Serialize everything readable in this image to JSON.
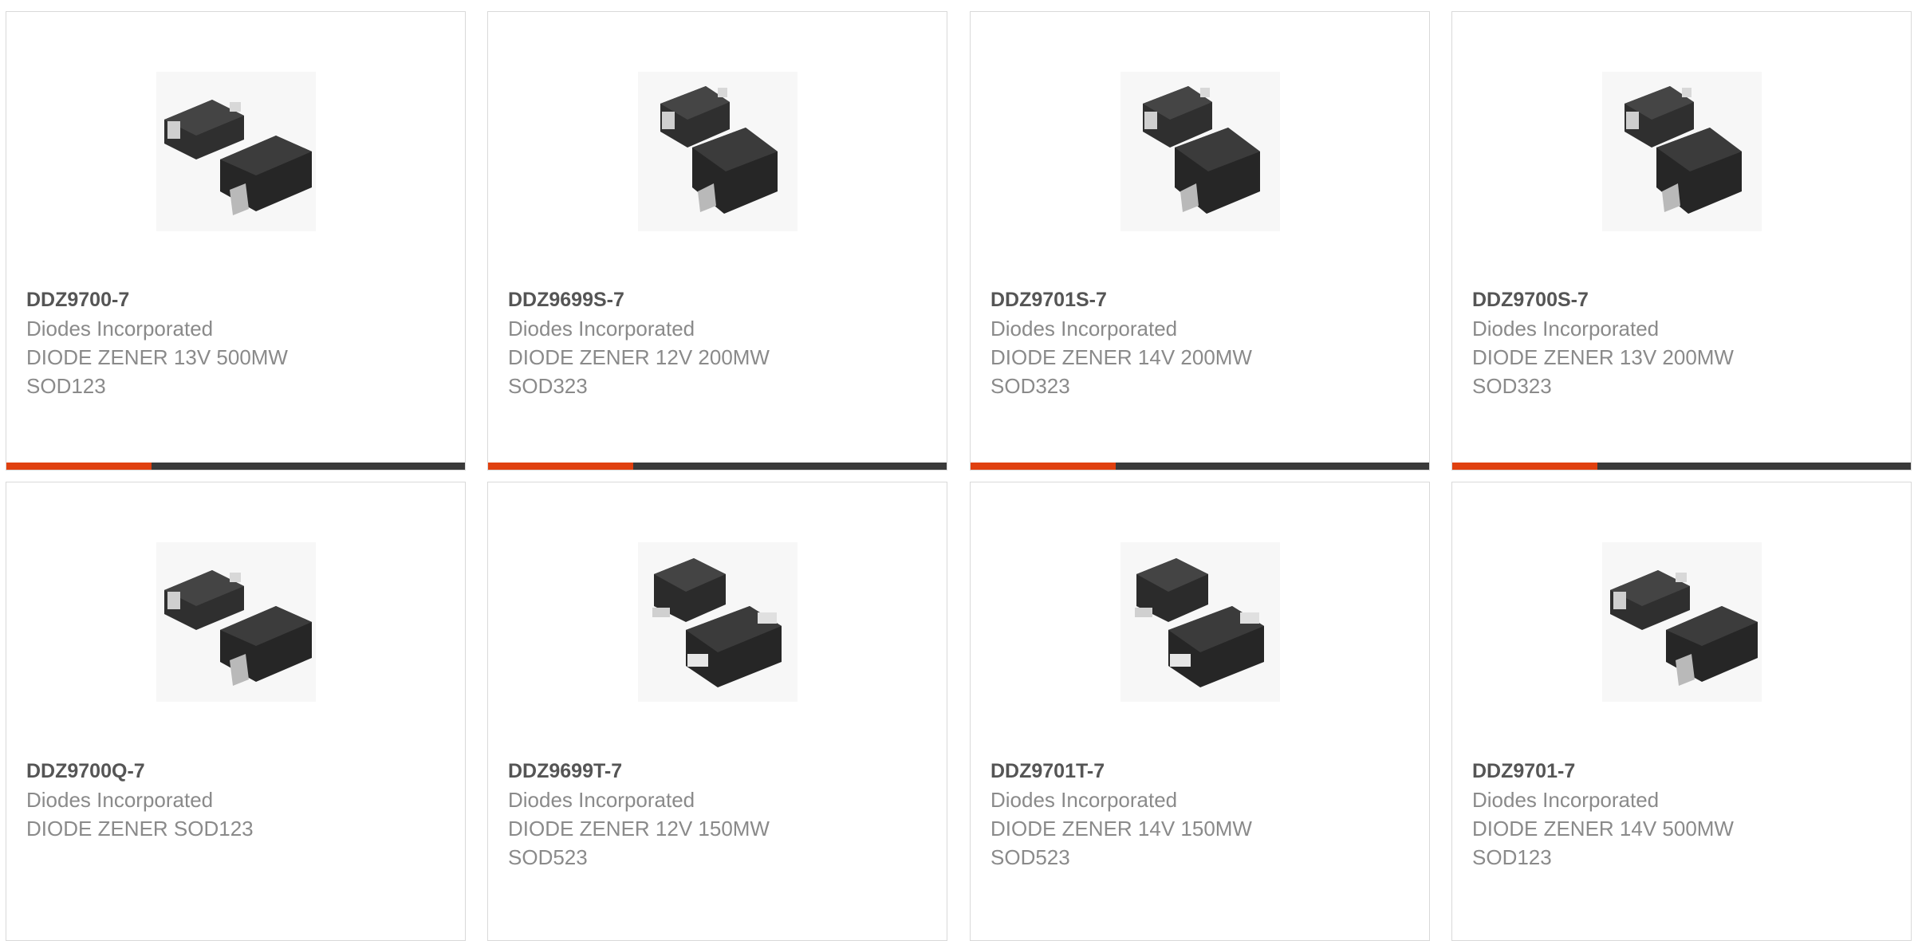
{
  "products": [
    {
      "part_number": "DDZ9700-7",
      "manufacturer": "Diodes Incorporated",
      "desc_line1": "DIODE ZENER 13V 500MW",
      "desc_line2": "SOD123",
      "package_icon": "sod123-package-icon"
    },
    {
      "part_number": "DDZ9699S-7",
      "manufacturer": "Diodes Incorporated",
      "desc_line1": "DIODE ZENER 12V 200MW",
      "desc_line2": "SOD323",
      "package_icon": "sod323-package-icon"
    },
    {
      "part_number": "DDZ9701S-7",
      "manufacturer": "Diodes Incorporated",
      "desc_line1": "DIODE ZENER 14V 200MW",
      "desc_line2": "SOD323",
      "package_icon": "sod323-package-icon"
    },
    {
      "part_number": "DDZ9700S-7",
      "manufacturer": "Diodes Incorporated",
      "desc_line1": "DIODE ZENER 13V 200MW",
      "desc_line2": "SOD323",
      "package_icon": "sod323-package-icon"
    },
    {
      "part_number": "DDZ9700Q-7",
      "manufacturer": "Diodes Incorporated",
      "desc_line1": "DIODE ZENER SOD123",
      "desc_line2": "",
      "package_icon": "sod123-package-icon"
    },
    {
      "part_number": "DDZ9699T-7",
      "manufacturer": "Diodes Incorporated",
      "desc_line1": "DIODE ZENER 12V 150MW",
      "desc_line2": "SOD523",
      "package_icon": "sod523-package-icon"
    },
    {
      "part_number": "DDZ9701T-7",
      "manufacturer": "Diodes Incorporated",
      "desc_line1": "DIODE ZENER 14V 150MW",
      "desc_line2": "SOD523",
      "package_icon": "sod523-package-icon"
    },
    {
      "part_number": "DDZ9701-7",
      "manufacturer": "Diodes Incorporated",
      "desc_line1": "DIODE ZENER 14V 500MW",
      "desc_line2": "SOD123",
      "package_icon": "sod123-package-icon"
    }
  ],
  "colors": {
    "accent": "#e0400f",
    "bar_dark": "#3a3a3a",
    "border": "#d9d9d9",
    "part_text": "#555555",
    "body_text": "#8a8a8a"
  }
}
